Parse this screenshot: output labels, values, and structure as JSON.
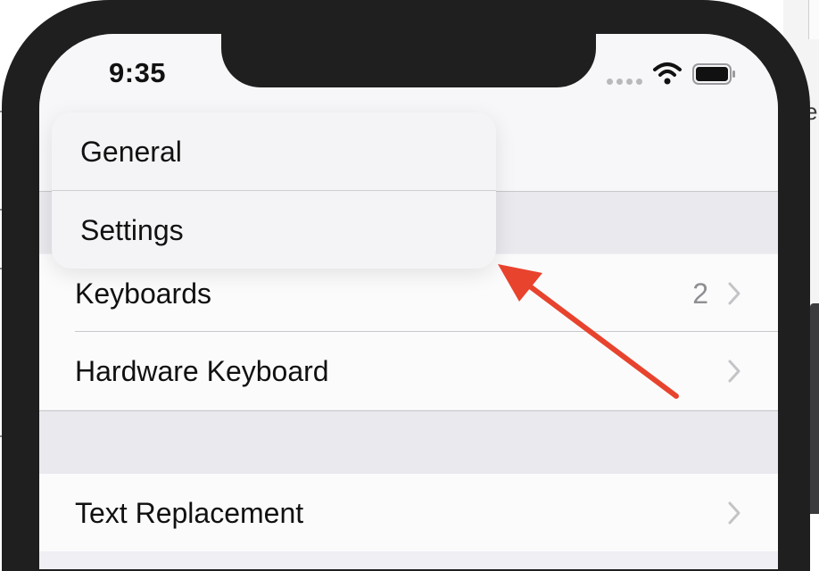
{
  "status_bar": {
    "time": "9:35",
    "icons": [
      "signal-icon",
      "wifi-icon",
      "battery-icon"
    ]
  },
  "context_menu": {
    "items": [
      {
        "label": "General"
      },
      {
        "label": "Settings"
      }
    ]
  },
  "list": {
    "rows": [
      {
        "label": "Keyboards",
        "detail": "2"
      },
      {
        "label": "Hardware Keyboard",
        "detail": ""
      },
      {
        "label": "Text Replacement",
        "detail": ""
      }
    ]
  },
  "annotation": {
    "arrow_color": "#e8432d"
  },
  "colors": {
    "phone_frame": "#1f1f1f",
    "background": "#efeff4",
    "text": "#111111",
    "secondary_text": "#8e8e93"
  }
}
